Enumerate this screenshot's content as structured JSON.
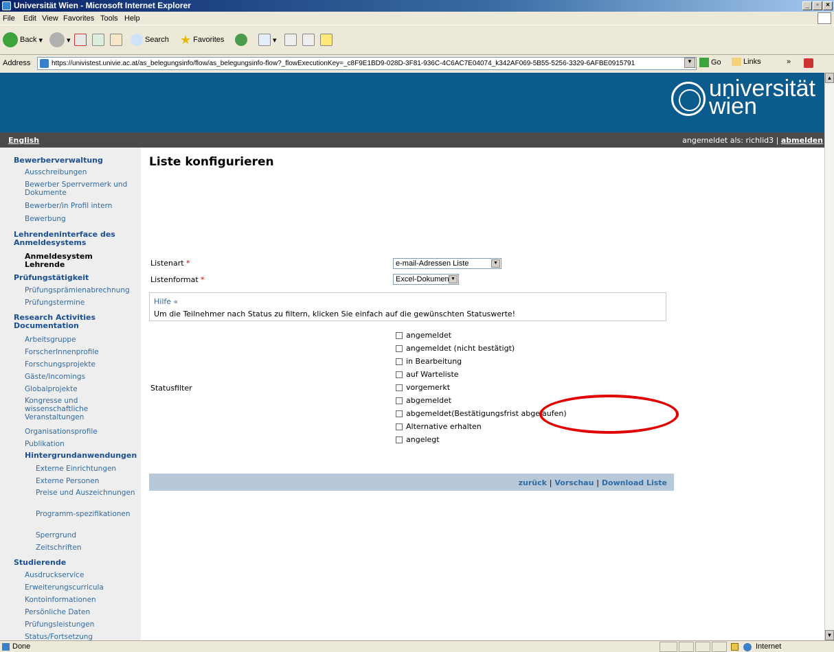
{
  "window": {
    "title": "Universität Wien - Microsoft Internet Explorer"
  },
  "menu": [
    "File",
    "Edit",
    "View",
    "Favorites",
    "Tools",
    "Help"
  ],
  "toolbar": {
    "back": "Back",
    "search": "Search",
    "favorites": "Favorites"
  },
  "address": {
    "label": "Address",
    "url": "https://univistest.univie.ac.at/as_belegungsinfo/flow/as_belegungsinfo-flow?_flowExecutionKey=_c8F9E1BD9-028D-3F81-936C-4C6AC7E04074_k342AF069-5B55-5256-3329-6AFBE0915791",
    "go": "Go",
    "links": "Links"
  },
  "site": {
    "brand_line1": "universität",
    "brand_line2": "wien",
    "language": "English",
    "logged_in_as": "angemeldet als: richlid3 |",
    "logout": "abmelden"
  },
  "sidebar": [
    {
      "label": "Bewerberverwaltung",
      "type": "h"
    },
    {
      "label": "Ausschreibungen",
      "type": "l"
    },
    {
      "label": "Bewerber Sperrvermerk und Dokumente",
      "type": "l"
    },
    {
      "label": "Bewerber/in Profil intern",
      "type": "l"
    },
    {
      "label": "Bewerbung",
      "type": "l"
    },
    {
      "label": "Lehrendeninterface des Anmeldesystems",
      "type": "h"
    },
    {
      "label": "Anmeldesystem Lehrende",
      "type": "active"
    },
    {
      "label": "Prüfungstätigkeit",
      "type": "h"
    },
    {
      "label": "Prüfungsprämienabrechnung",
      "type": "l"
    },
    {
      "label": "Prüfungstermine",
      "type": "l"
    },
    {
      "label": "Research Activities Documentation",
      "type": "h"
    },
    {
      "label": "Arbeitsgruppe",
      "type": "l"
    },
    {
      "label": "ForscherInnenprofile",
      "type": "l"
    },
    {
      "label": "Forschungsprojekte",
      "type": "l"
    },
    {
      "label": "Gäste/Incomings",
      "type": "l"
    },
    {
      "label": "Globalprojekte",
      "type": "l"
    },
    {
      "label": "Kongresse und wissenschaftliche Veranstaltungen",
      "type": "l"
    },
    {
      "label": "Organisationsprofile",
      "type": "l"
    },
    {
      "label": "Publikation",
      "type": "l"
    },
    {
      "label": "Hintergrundanwendungen",
      "type": "h"
    },
    {
      "label": "Externe Einrichtungen",
      "type": "l"
    },
    {
      "label": "Externe Personen",
      "type": "l"
    },
    {
      "label": "Preise und Auszeichnungen",
      "type": "l"
    },
    {
      "label": "Programm-spezifikationen",
      "type": "l"
    },
    {
      "label": "Sperrgrund",
      "type": "l"
    },
    {
      "label": "Zeitschriften",
      "type": "l"
    },
    {
      "label": "Studierende",
      "type": "h"
    },
    {
      "label": "Ausdruckservice",
      "type": "l"
    },
    {
      "label": "Erweiterungscurricula",
      "type": "l"
    },
    {
      "label": "Kontoinformationen",
      "type": "l"
    },
    {
      "label": "Persönliche Daten",
      "type": "l"
    },
    {
      "label": "Prüfungsleistungen",
      "type": "l"
    },
    {
      "label": "Status/Fortsetzung",
      "type": "l"
    }
  ],
  "main": {
    "title": "Liste konfigurieren",
    "listenart_label": "Listenart",
    "listenart_value": "e-mail-Adressen Liste",
    "listenformat_label": "Listenformat",
    "listenformat_value": "Excel-Dokument",
    "required_mark": "*",
    "help_link": "Hilfe «",
    "help_text": "Um die Teilnehmer nach Status zu filtern, klicken Sie einfach auf die gewünschten Statuswerte!",
    "statusfilter_label": "Statusfilter",
    "statuses": [
      "angemeldet",
      "angemeldet (nicht bestätigt)",
      "in Bearbeitung",
      "auf Warteliste",
      "vorgemerkt",
      "abgemeldet",
      "abgemeldet(Bestätigungsfrist abgelaufen)",
      "Alternative erhalten",
      "angelegt"
    ],
    "actions": {
      "back": "zurück",
      "preview": "Vorschau",
      "download": "Download Liste",
      "separator": "|"
    }
  },
  "status": {
    "text": "Done",
    "zone": "Internet"
  },
  "colors": {
    "banner": "#0B5B8C",
    "subbar": "#4A4A4A",
    "sidebar": "#EEEEEE",
    "actionbar": "#B7C9D9",
    "highlight": "#E00000",
    "link": "#2F6AA3",
    "heading": "#1B4F93"
  }
}
